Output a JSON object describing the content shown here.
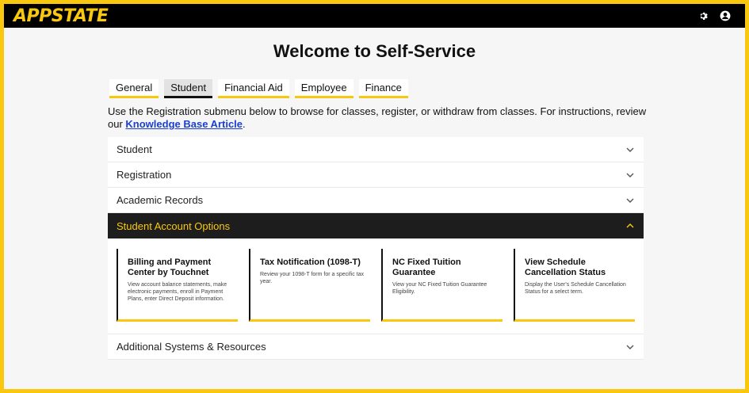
{
  "brand": {
    "logo_text": "APPSTATE",
    "accent": "#f9c80e"
  },
  "topbar": {
    "icons": [
      "gear-icon",
      "user-icon"
    ]
  },
  "page": {
    "title": "Welcome to Self-Service"
  },
  "tabs": [
    {
      "label": "General",
      "active": false
    },
    {
      "label": "Student",
      "active": true
    },
    {
      "label": "Financial Aid",
      "active": false
    },
    {
      "label": "Employee",
      "active": false
    },
    {
      "label": "Finance",
      "active": false
    }
  ],
  "intro": {
    "text_before": "Use the Registration submenu below to browse for classes, register, or withdraw from classes. For instructions, review our ",
    "link_text": "Knowledge Base Article",
    "text_after": "."
  },
  "accordion": {
    "sections": [
      {
        "label": "Student",
        "open": false
      },
      {
        "label": "Registration",
        "open": false
      },
      {
        "label": "Academic Records",
        "open": false
      },
      {
        "label": "Student Account Options",
        "open": true
      },
      {
        "label": "Additional Systems & Resources",
        "open": false
      }
    ],
    "cards": [
      {
        "title": "Billing and Payment Center by Touchnet",
        "desc": "View account balance statements, make electronic payments, enroll in Payment Plans, enter Direct Deposit information."
      },
      {
        "title": "Tax Notification (1098-T)",
        "desc": "Review your 1098-T form for a specific tax year."
      },
      {
        "title": "NC Fixed Tuition Guarantee",
        "desc": "View your NC Fixed Tuition Guarantee Eligibility."
      },
      {
        "title": "View Schedule Cancellation Status",
        "desc": "Display the User's Schedule Cancellation Status for a select term."
      }
    ]
  }
}
